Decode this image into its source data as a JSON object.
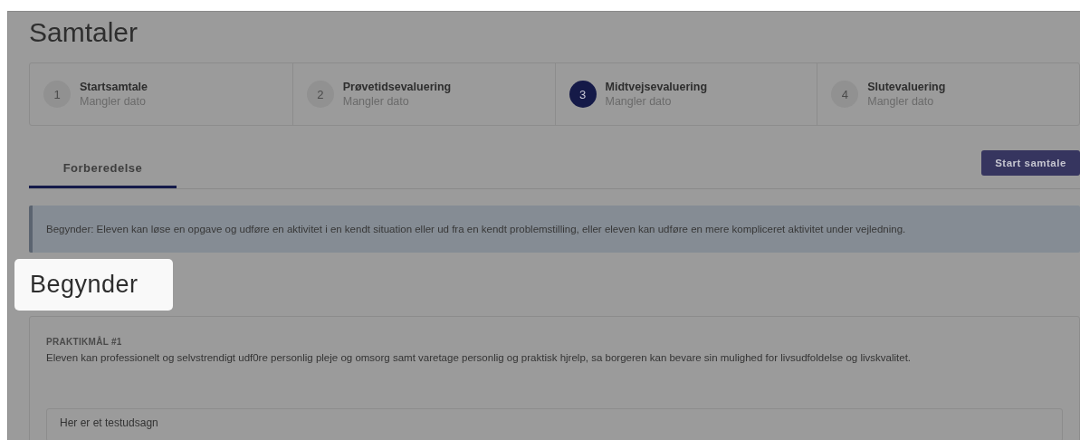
{
  "page_title": "Samtaler",
  "steps": [
    {
      "number": "1",
      "title": "Startsamtale",
      "subtitle": "Mangler dato",
      "selected": false
    },
    {
      "number": "2",
      "title": "Prøvetidsevaluering",
      "subtitle": "Mangler dato",
      "selected": false
    },
    {
      "number": "3",
      "title": "Midtvejsevaluering",
      "subtitle": "Mangler dato",
      "selected": true
    },
    {
      "number": "4",
      "title": "Slutevaluering",
      "subtitle": "Mangler dato",
      "selected": false
    }
  ],
  "tabs": [
    {
      "label": "Forberedelse",
      "selected": true
    }
  ],
  "start_button": "Start samtale",
  "info_banner": "Begynder: Eleven kan løse en opgave og udføre en aktivitet i en kendt situation eller ud fra en kendt problemstilling, eller eleven kan udføre en mere kompliceret aktivitet under vejledning.",
  "level_heading": "Begynder",
  "goal_card": {
    "label": "PRAKTIKMÅL #1",
    "text": "Eleven kan professionelt og selvstrendigt udf0re personlig pleje og omsorg samt varetage personlig og praktisk hjrelp, sa borgeren kan bevare sin mulighed for livsudfoldelse og livskvalitet.",
    "statement": "Her er et testudsagn"
  }
}
